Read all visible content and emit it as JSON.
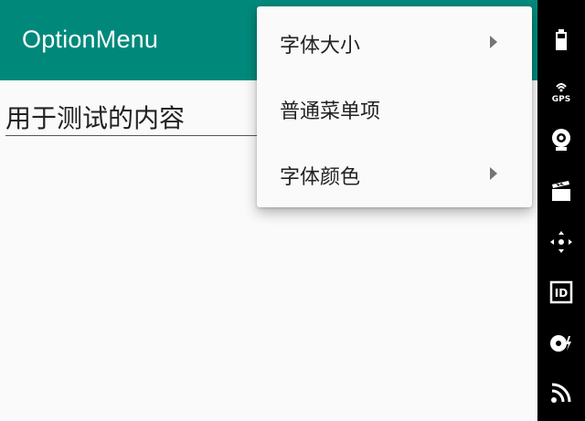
{
  "app": {
    "title": "OptionMenu",
    "content_text": "用于测试的内容"
  },
  "menu": {
    "items": [
      {
        "label": "字体大小",
        "has_submenu": true
      },
      {
        "label": "普通菜单项",
        "has_submenu": false
      },
      {
        "label": "字体颜色",
        "has_submenu": true
      }
    ]
  },
  "emulator_sidebar": {
    "icons": [
      "battery-icon",
      "gps-icon",
      "camera-icon",
      "media-icon",
      "dpad-icon",
      "id-icon",
      "disc-icon",
      "rss-icon"
    ],
    "gps_label": "GPS",
    "id_label": "ID"
  },
  "colors": {
    "appbar": "#00897b",
    "background": "#fafafa",
    "sidebar": "#000000"
  }
}
